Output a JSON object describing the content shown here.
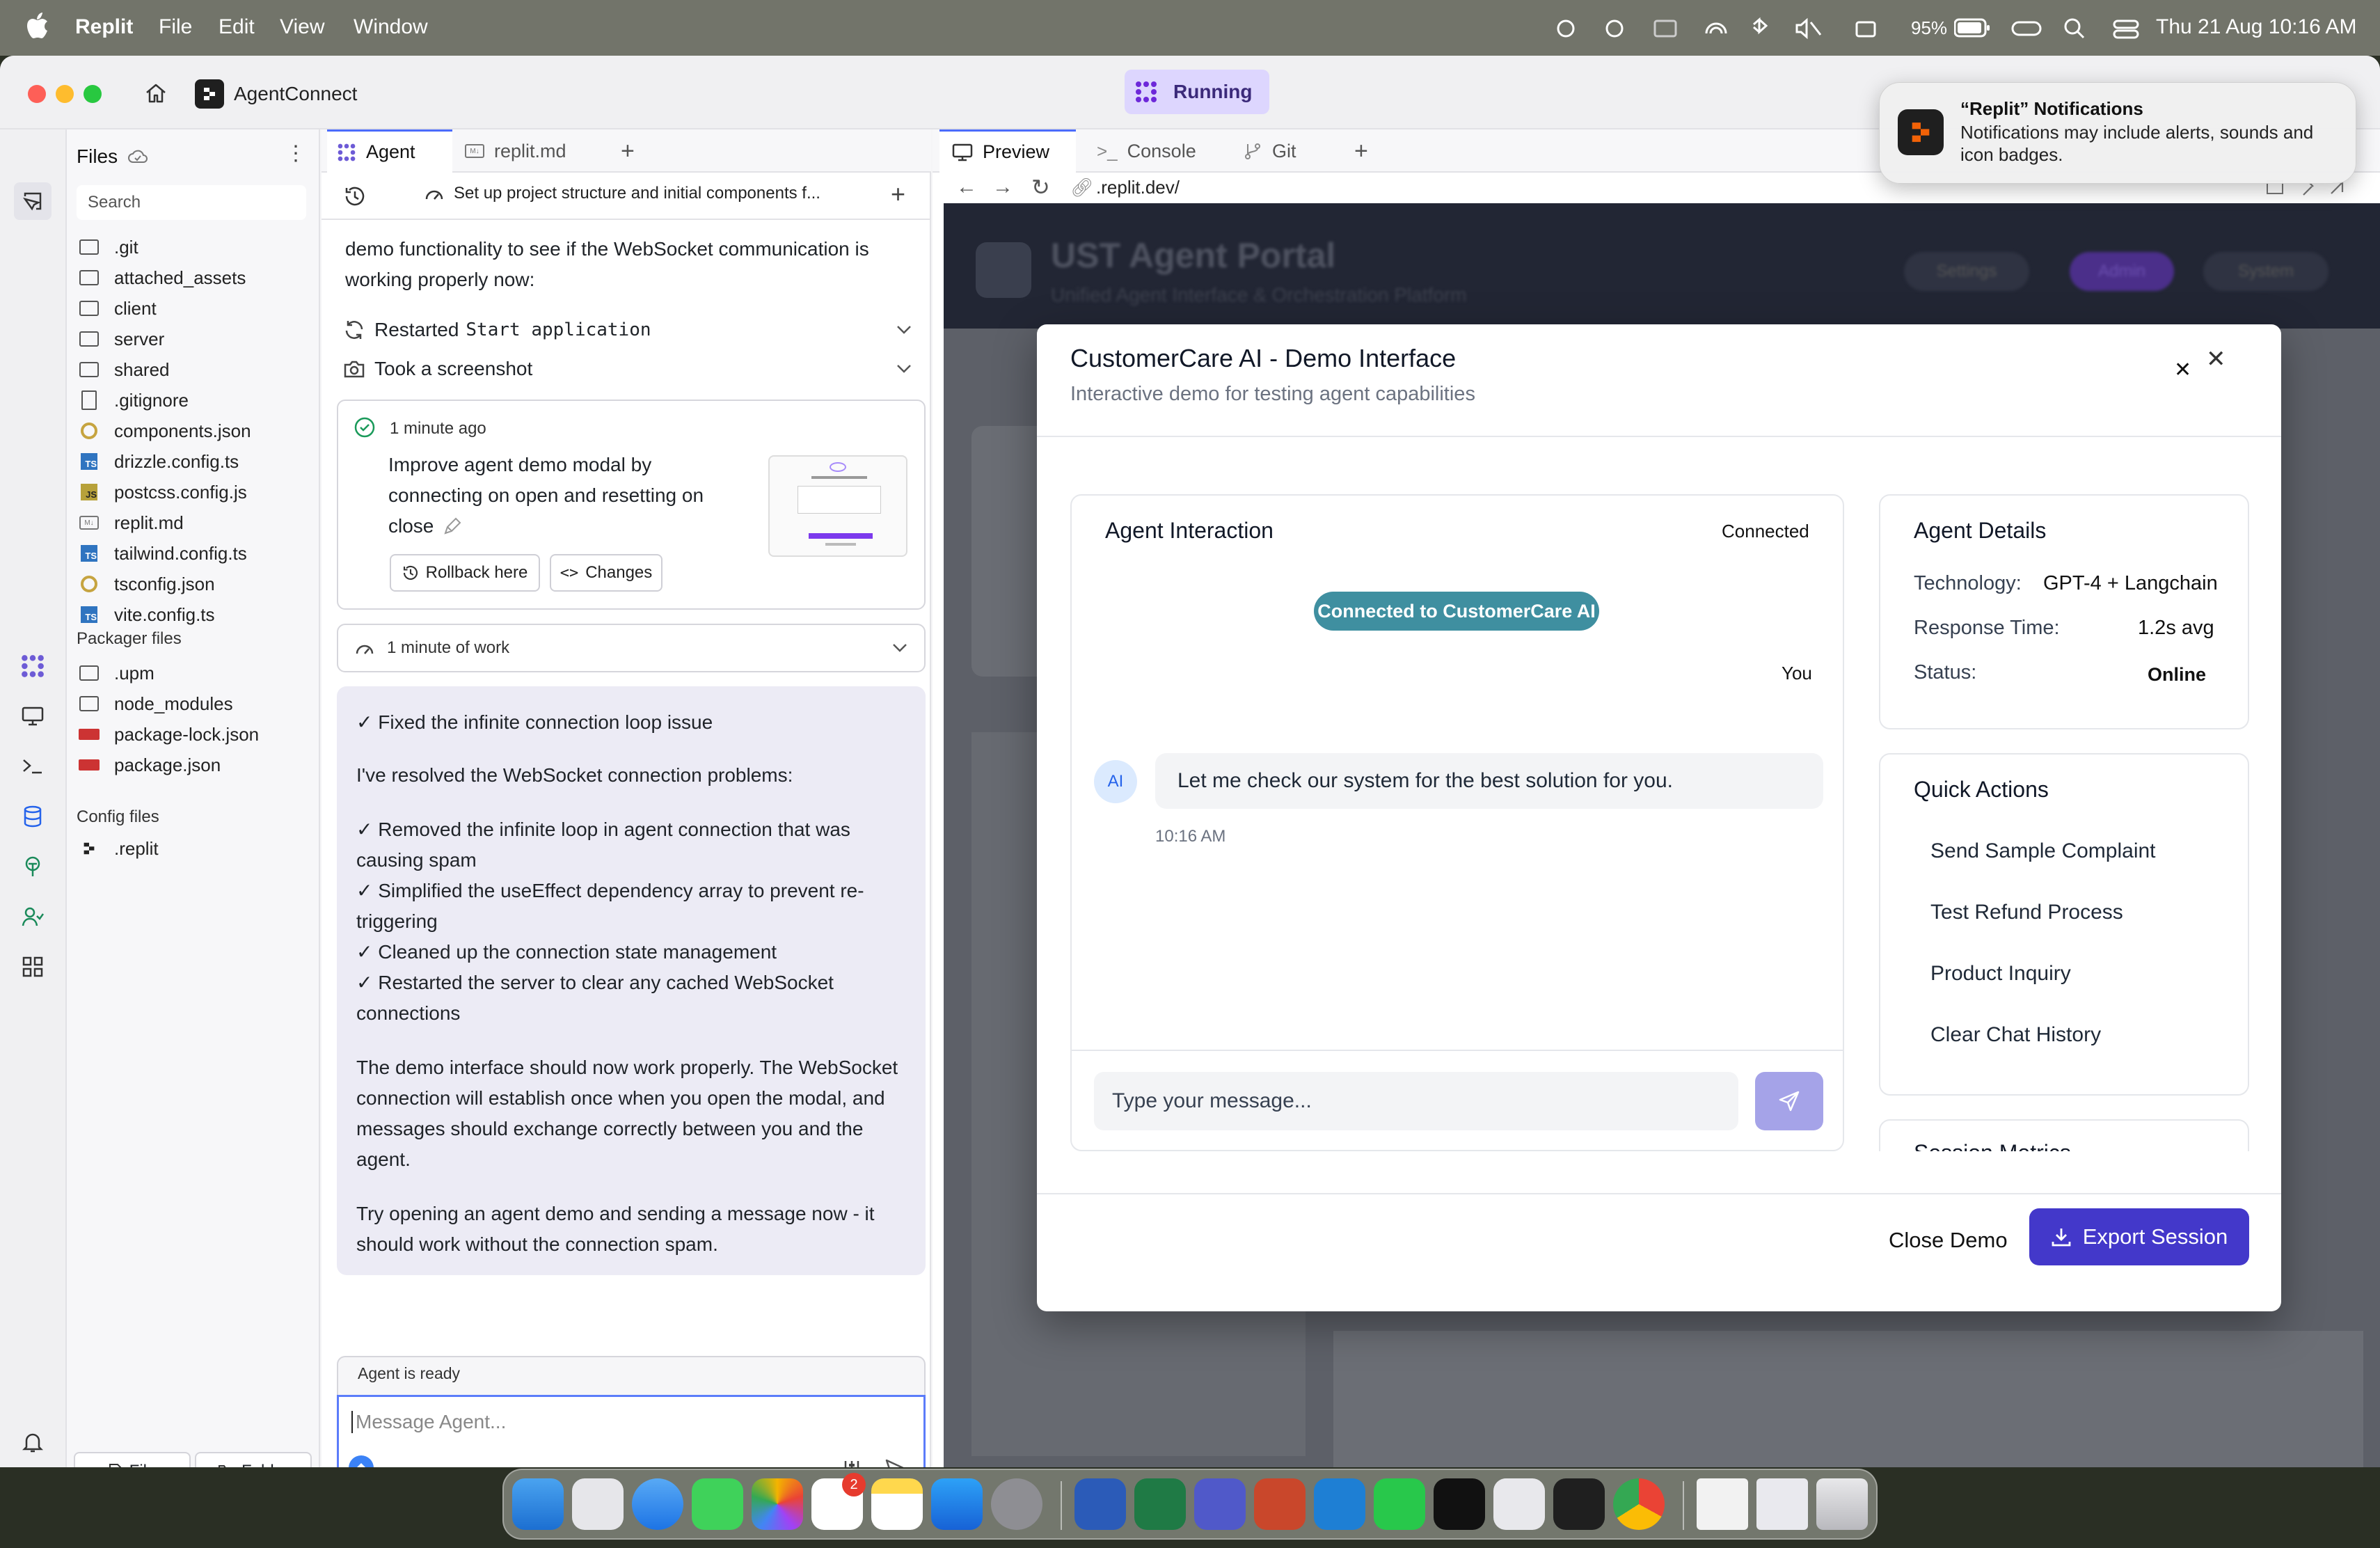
{
  "menubar": {
    "app_name": "Replit",
    "menus": [
      "File",
      "Edit",
      "View",
      "Window"
    ],
    "battery": "95%",
    "datetime": "Thu 21 Aug  10:16 AM"
  },
  "notification": {
    "title": "“Replit” Notifications",
    "body_line1": "Notifications may include alerts, sounds and",
    "body_line2": "icon badges."
  },
  "titlebar": {
    "project_name": "AgentConnect",
    "status": "Running"
  },
  "files": {
    "header": "Files",
    "search_placeholder": "Search",
    "items": [
      ".git",
      "attached_assets",
      "client",
      "server",
      "shared",
      ".gitignore",
      "components.json",
      "drizzle.config.ts",
      "postcss.config.js",
      "replit.md",
      "tailwind.config.ts",
      "tsconfig.json",
      "vite.config.ts"
    ],
    "packager_header": "Packager files",
    "packager_items": [
      ".upm",
      "node_modules",
      "package-lock.json",
      "package.json"
    ],
    "config_header": "Config files",
    "config_items": [
      ".replit"
    ],
    "new_file": "File",
    "new_folder": "Folder"
  },
  "agent": {
    "tabs": [
      "Agent",
      "replit.md"
    ],
    "thread_title": "Set up project structure and initial components f...",
    "intro_line1": "demo functionality to see if the WebSocket communication is",
    "intro_line2": "working properly now:",
    "action1_prefix": "Restarted",
    "action1_code": "Start application",
    "action2": "Took a screenshot",
    "checkpoint": {
      "time": "1 minute ago",
      "line1": "Improve agent demo modal by",
      "line2": "connecting on open and resetting on",
      "line3": "close",
      "rollback": "Rollback here",
      "changes": "Changes"
    },
    "work_summary": "1 minute of work",
    "message": {
      "heading": "✓ Fixed the infinite connection loop issue",
      "p1": "I've resolved the WebSocket connection problems:",
      "b1a": "✓ Removed the infinite loop in agent connection that was",
      "b1b": "causing spam",
      "b2a": "✓ Simplified the useEffect dependency array to prevent re-",
      "b2b": "triggering",
      "b3": "✓ Cleaned up the connection state management",
      "b4a": "✓ Restarted the server to clear any cached WebSocket",
      "b4b": "connections",
      "p2a": "The demo interface should now work properly. The WebSocket",
      "p2b": "connection will establish once when you open the modal, and",
      "p2c": "messages should exchange correctly between you and the",
      "p2d": "agent.",
      "p3a": "Try opening an agent demo and sending a message now - it",
      "p3b": "should work without the connection spam."
    },
    "status": "Agent is ready",
    "input_placeholder": "Message Agent..."
  },
  "preview": {
    "tabs": [
      "Preview",
      "Console",
      "Git"
    ],
    "url": ".replit.dev/",
    "bg_title": "UST Agent Portal",
    "bg_subtitle": "Unified Agent Interface & Orchestration Platform",
    "bg_buttons": [
      "Settings",
      "Admin",
      "System"
    ]
  },
  "modal": {
    "title": "CustomerCare AI - Demo Interface",
    "subtitle": "Interactive demo for testing agent capabilities",
    "interaction": {
      "title": "Agent Interaction",
      "status": "Connected",
      "connected_pill": "Connected to CustomerCare AI",
      "you_label": "You",
      "ai_avatar": "AI",
      "ai_message": "Let me check our system for the best solution for you.",
      "ai_time": "10:16 AM",
      "input_placeholder": "Type your message..."
    },
    "details": {
      "title": "Agent Details",
      "rows": [
        {
          "label": "Technology:",
          "value": "GPT-4 + Langchain"
        },
        {
          "label": "Response Time:",
          "value": "1.2s avg"
        },
        {
          "label": "Status:",
          "value": "Online"
        }
      ]
    },
    "quick_actions": {
      "title": "Quick Actions",
      "items": [
        "Send Sample Complaint",
        "Test Refund Process",
        "Product Inquiry",
        "Clear Chat History"
      ]
    },
    "session_metrics_title": "Session Metrics",
    "close_button": "Close Demo",
    "export_button": "Export Session"
  },
  "colors": {
    "accent": "#4338ca",
    "pill": "#3f8fa0",
    "running_bg": "#ddd6fe",
    "send_disabled": "#a5a3e8"
  },
  "dock": {
    "reminders_badge": "2"
  }
}
